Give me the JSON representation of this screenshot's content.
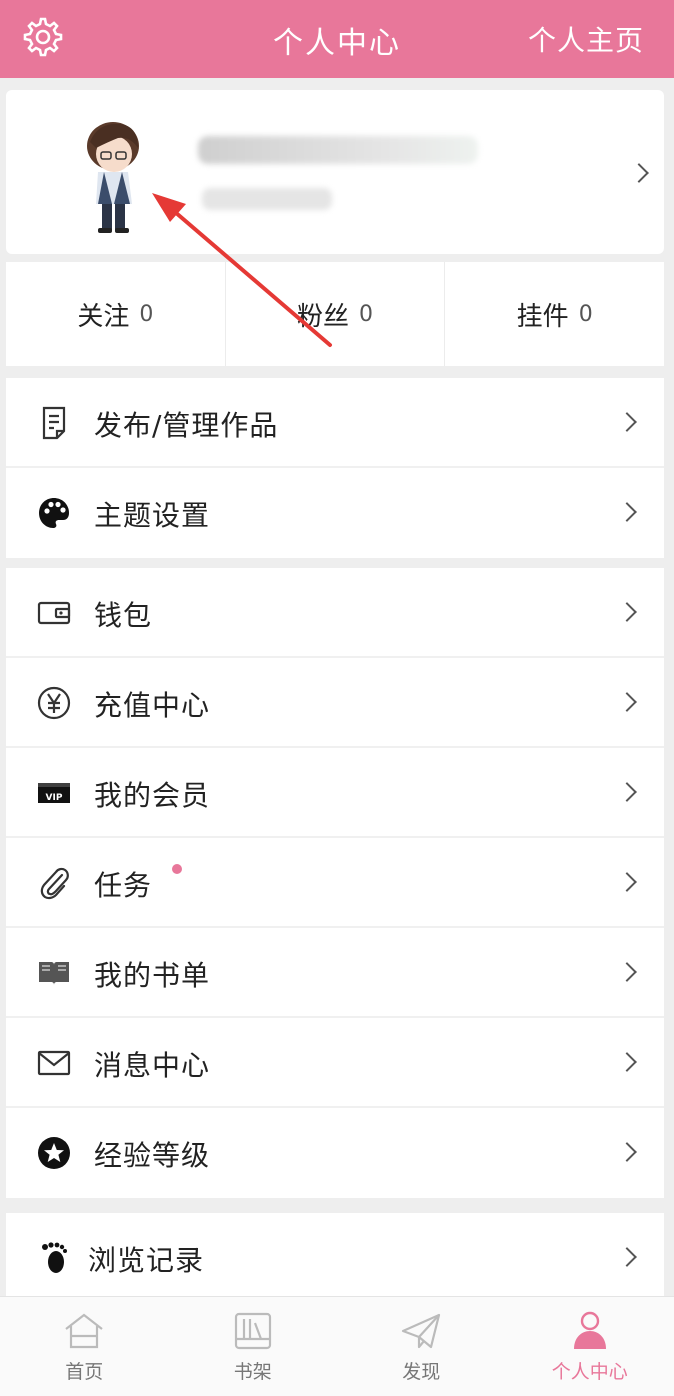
{
  "header": {
    "title": "个人中心",
    "home_link": "个人主页",
    "color": "#e8779a"
  },
  "stats": [
    {
      "label": "关注",
      "count": "0"
    },
    {
      "label": "粉丝",
      "count": "0"
    },
    {
      "label": "挂件",
      "count": "0"
    }
  ],
  "menu": {
    "group1": [
      {
        "label": "发布/管理作品",
        "icon": "document-icon"
      },
      {
        "label": "主题设置",
        "icon": "palette-icon"
      }
    ],
    "group2": [
      {
        "label": "钱包",
        "icon": "wallet-icon"
      },
      {
        "label": "充值中心",
        "icon": "yuan-icon"
      },
      {
        "label": "我的会员",
        "icon": "vip-icon"
      },
      {
        "label": "任务",
        "icon": "paperclip-icon",
        "badge": true
      },
      {
        "label": "我的书单",
        "icon": "book-icon"
      },
      {
        "label": "消息中心",
        "icon": "mail-icon"
      },
      {
        "label": "经验等级",
        "icon": "star-icon"
      }
    ],
    "group3": [
      {
        "label": "浏览记录",
        "icon": "footprint-icon"
      }
    ]
  },
  "tabbar": [
    {
      "label": "首页",
      "icon": "home-icon"
    },
    {
      "label": "书架",
      "icon": "bookshelf-icon"
    },
    {
      "label": "发现",
      "icon": "paper-plane-icon"
    },
    {
      "label": "个人中心",
      "icon": "person-icon",
      "active": true
    }
  ],
  "accent_color": "#e8779a",
  "annotation_arrow_color": "#e53935"
}
